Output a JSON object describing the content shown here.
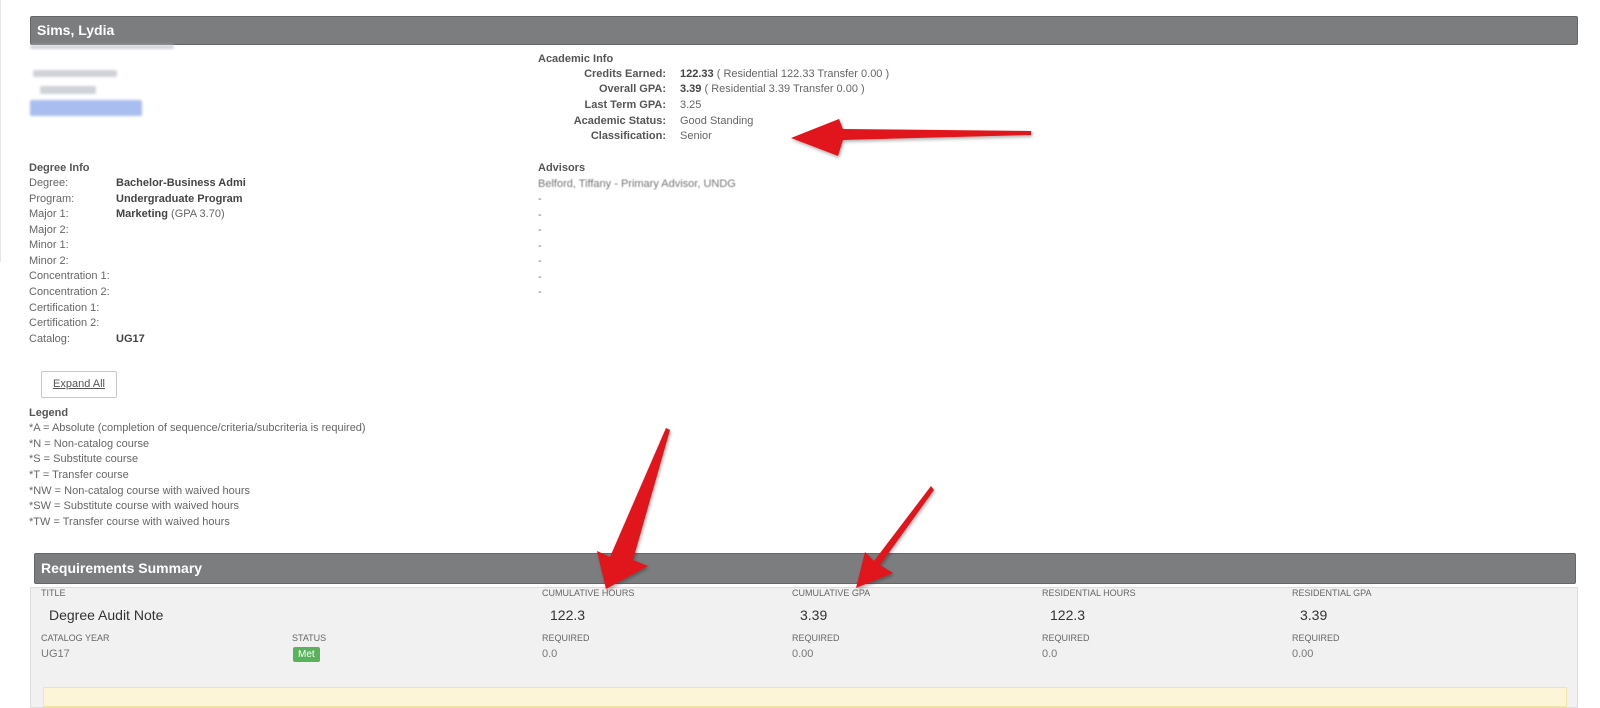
{
  "student": {
    "name": "Sims, Lydia"
  },
  "academic_info": {
    "heading": "Academic Info",
    "rows": [
      {
        "label": "Credits Earned:",
        "value": "122.33",
        "detail": "( Residential 122.33 Transfer 0.00 )"
      },
      {
        "label": "Overall GPA:",
        "value": "3.39",
        "detail": "( Residential 3.39 Transfer 0.00 )"
      },
      {
        "label": "Last Term GPA:",
        "value": "",
        "detail": "3.25"
      },
      {
        "label": "Academic Status:",
        "value": "",
        "detail": "Good Standing"
      },
      {
        "label": "Classification:",
        "value": "",
        "detail": "Senior"
      }
    ]
  },
  "degree_info": {
    "heading": "Degree Info",
    "rows": [
      {
        "label": "Degree:",
        "value": "Bachelor-Business Admi",
        "extra": ""
      },
      {
        "label": "Program:",
        "value": "Undergraduate Program",
        "extra": ""
      },
      {
        "label": "Major 1:",
        "value": "Marketing",
        "extra": "(GPA 3.70)"
      },
      {
        "label": "Major 2:",
        "value": "",
        "extra": ""
      },
      {
        "label": "Minor 1:",
        "value": "",
        "extra": ""
      },
      {
        "label": "Minor 2:",
        "value": "",
        "extra": ""
      },
      {
        "label": "Concentration 1:",
        "value": "",
        "extra": ""
      },
      {
        "label": "Concentration 2:",
        "value": "",
        "extra": ""
      },
      {
        "label": "Certification 1:",
        "value": "",
        "extra": ""
      },
      {
        "label": "Certification 2:",
        "value": "",
        "extra": ""
      },
      {
        "label": "Catalog:",
        "value": "UG17",
        "extra": ""
      }
    ]
  },
  "advisors": {
    "heading": "Advisors",
    "primary": "Belford, Tiffany - Primary Advisor, UNDG",
    "rest": [
      "-",
      "-",
      "-",
      "-",
      "-",
      "-",
      "-"
    ]
  },
  "expand_all_label": "Expand All",
  "legend": {
    "heading": "Legend",
    "items": [
      "*A = Absolute (completion of sequence/criteria/subcriteria is required)",
      "*N = Non-catalog course",
      "*S = Substitute course",
      "*T = Transfer course",
      "*NW = Non-catalog course with waived hours",
      "*SW = Substitute course with waived hours",
      "*TW = Transfer course with waived hours"
    ]
  },
  "requirements_summary": {
    "heading": "Requirements Summary",
    "title_header": "TITLE",
    "title_value": "Degree Audit Note",
    "catalog_year_header": "CATALOG YEAR",
    "catalog_year_value": "UG17",
    "status_header": "STATUS",
    "status_value": "Met",
    "columns": [
      {
        "header": "CUMULATIVE HOURS",
        "value": "122.3",
        "required_label": "REQUIRED",
        "required_value": "0.0"
      },
      {
        "header": "CUMULATIVE GPA",
        "value": "3.39",
        "required_label": "REQUIRED",
        "required_value": "0.00"
      },
      {
        "header": "RESIDENTIAL HOURS",
        "value": "122.3",
        "required_label": "REQUIRED",
        "required_value": "0.0"
      },
      {
        "header": "RESIDENTIAL GPA",
        "value": "3.39",
        "required_label": "REQUIRED",
        "required_value": "0.00"
      }
    ]
  },
  "colors": {
    "header_bar": "#7b7d7f",
    "status_red": "#d71e1e",
    "met_green": "#58b35a",
    "arrow_red": "#e0141a"
  }
}
